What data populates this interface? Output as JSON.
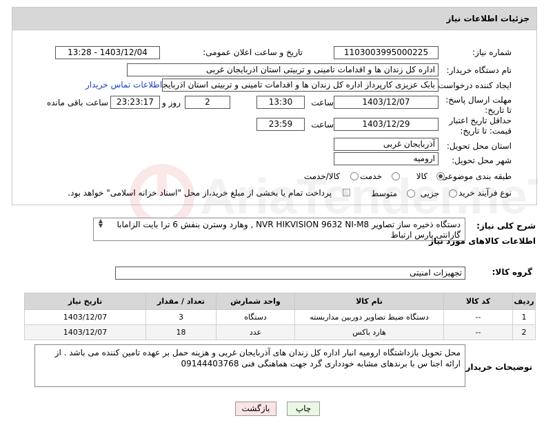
{
  "panel_title": "جزئیات اطلاعات نیاز",
  "need_number": {
    "label": "شماره نیاز:",
    "value": "1103003995000225"
  },
  "announce": {
    "label": "تاریخ و ساعت اعلان عمومی:",
    "value": "1403/12/04 - 13:28"
  },
  "buyer_org": {
    "label": "نام دستگاه خریدار:",
    "value": "اداره کل زندان ها و اقدامات تامینی و تربیتی استان اذربایجان غربی"
  },
  "creator": {
    "label": "ایجاد کننده درخواست:",
    "value": "بابک عزیزی کارپرداز اداره کل زندان ها و اقدامات تامینی و تربیتی استان اذربایجان",
    "contact_link": "اطلاعات تماس خریدار"
  },
  "deadline": {
    "label": "مهلت ارسال پاسخ: تا تاریخ:",
    "date": "1403/12/07",
    "time_label": "ساعت",
    "time": "13:30",
    "days": "2",
    "days_label": "روز و",
    "remaining": "23:23:17",
    "remaining_label": "ساعت باقی مانده"
  },
  "validity": {
    "label": "حداقل تاریخ اعتبار قیمت: تا تاریخ:",
    "date": "1403/12/29",
    "time_label": "ساعت",
    "time": "23:59"
  },
  "province": {
    "label": "استان محل تحویل:",
    "value": "آذربایجان غربی"
  },
  "city": {
    "label": "شهر محل تحویل:",
    "value": "ارومیه"
  },
  "category": {
    "label": "طبقه بندی موضوعی:",
    "options": [
      "کالا",
      "خدمت",
      "کالا/خدمت"
    ],
    "selected": "کالا"
  },
  "process": {
    "label": "نوع فرآیند خرید :",
    "options": [
      "جزیی",
      "متوسط"
    ],
    "selected": "",
    "payment_note": "پرداخت تمام یا بخشی از مبلغ خرید،از محل \"اسناد خزانه اسلامی\" خواهد بود."
  },
  "general_desc": {
    "label": "شرح کلی نیاز:",
    "value": "دستگاه ذخیره ساز تصاویر NVR HIKVISION 9632 NI-M8 , وهارد وسترن بنفش 6 ترا بایت    الزامابا گارانتی پارس ارتباط"
  },
  "items_section_title": "اطلاعات کالاهای مورد نیاز",
  "goods_group": {
    "label": "گروه کالا:",
    "value": "تجهیزات امنیتی"
  },
  "table": {
    "headers": [
      "ردیف",
      "کد کالا",
      "نام کالا",
      "واحد شمارش",
      "تعداد / مقدار",
      "تاریخ نیاز"
    ],
    "rows": [
      [
        "1",
        "--",
        "دستگاه ضبط تصاویر دوربین مداربسته",
        "دستگاه",
        "3",
        "1403/12/07"
      ],
      [
        "2",
        "--",
        "هارد باکس",
        "عدد",
        "18",
        "1403/12/07"
      ]
    ]
  },
  "buyer_notes": {
    "label": "توضیحات خریدار:",
    "value": "محل تحویل بازداشتگاه ارومیه انبار اداره کل زندان های  آذربایجان غربی و هزینه حمل بر عهده تامین کننده می باشد . از ارائه اجنا س با برندهای مشابه خودداری گرد جهت هماهنگی فنی 09144403768"
  },
  "buttons": {
    "print": "چاپ",
    "back": "بازگشت"
  },
  "watermark_text": "AriaTender.neT"
}
